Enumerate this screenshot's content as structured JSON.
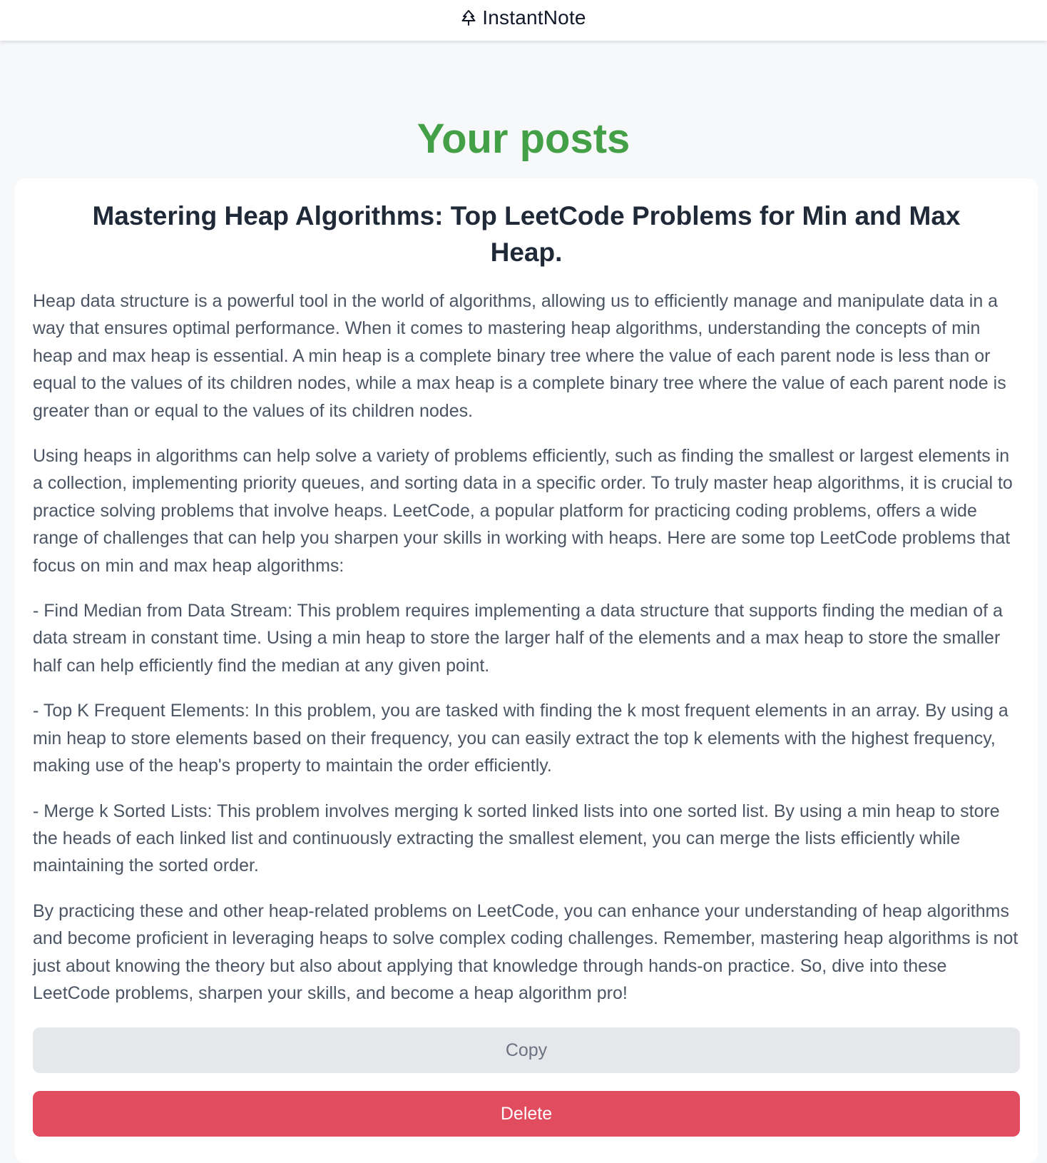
{
  "header": {
    "brand_name": "InstantNote",
    "logo_icon": "tree-icon"
  },
  "page": {
    "heading": "Your posts",
    "accent_color": "#43a047"
  },
  "post": {
    "title": "Mastering Heap Algorithms: Top LeetCode Problems for Min and Max Heap.",
    "paragraphs": [
      "Heap data structure is a powerful tool in the world of algorithms, allowing us to efficiently manage and manipulate data in a way that ensures optimal performance. When it comes to mastering heap algorithms, understanding the concepts of min heap and max heap is essential. A min heap is a complete binary tree where the value of each parent node is less than or equal to the values of its children nodes, while a max heap is a complete binary tree where the value of each parent node is greater than or equal to the values of its children nodes.",
      "Using heaps in algorithms can help solve a variety of problems efficiently, such as finding the smallest or largest elements in a collection, implementing priority queues, and sorting data in a specific order. To truly master heap algorithms, it is crucial to practice solving problems that involve heaps. LeetCode, a popular platform for practicing coding problems, offers a wide range of challenges that can help you sharpen your skills in working with heaps. Here are some top LeetCode problems that focus on min and max heap algorithms:",
      "- Find Median from Data Stream: This problem requires implementing a data structure that supports finding the median of a data stream in constant time. Using a min heap to store the larger half of the elements and a max heap to store the smaller half can help efficiently find the median at any given point.",
      "- Top K Frequent Elements: In this problem, you are tasked with finding the k most frequent elements in an array. By using a min heap to store elements based on their frequency, you can easily extract the top k elements with the highest frequency, making use of the heap's property to maintain the order efficiently.",
      "- Merge k Sorted Lists: This problem involves merging k sorted linked lists into one sorted list. By using a min heap to store the heads of each linked list and continuously extracting the smallest element, you can merge the lists efficiently while maintaining the sorted order.",
      "By practicing these and other heap-related problems on LeetCode, you can enhance your understanding of heap algorithms and become proficient in leveraging heaps to solve complex coding challenges. Remember, mastering heap algorithms is not just about knowing the theory but also about applying that knowledge through hands-on practice. So, dive into these LeetCode problems, sharpen your skills, and become a heap algorithm pro!"
    ],
    "copy_label": "Copy",
    "delete_label": "Delete",
    "delete_color": "#e24c5f"
  }
}
